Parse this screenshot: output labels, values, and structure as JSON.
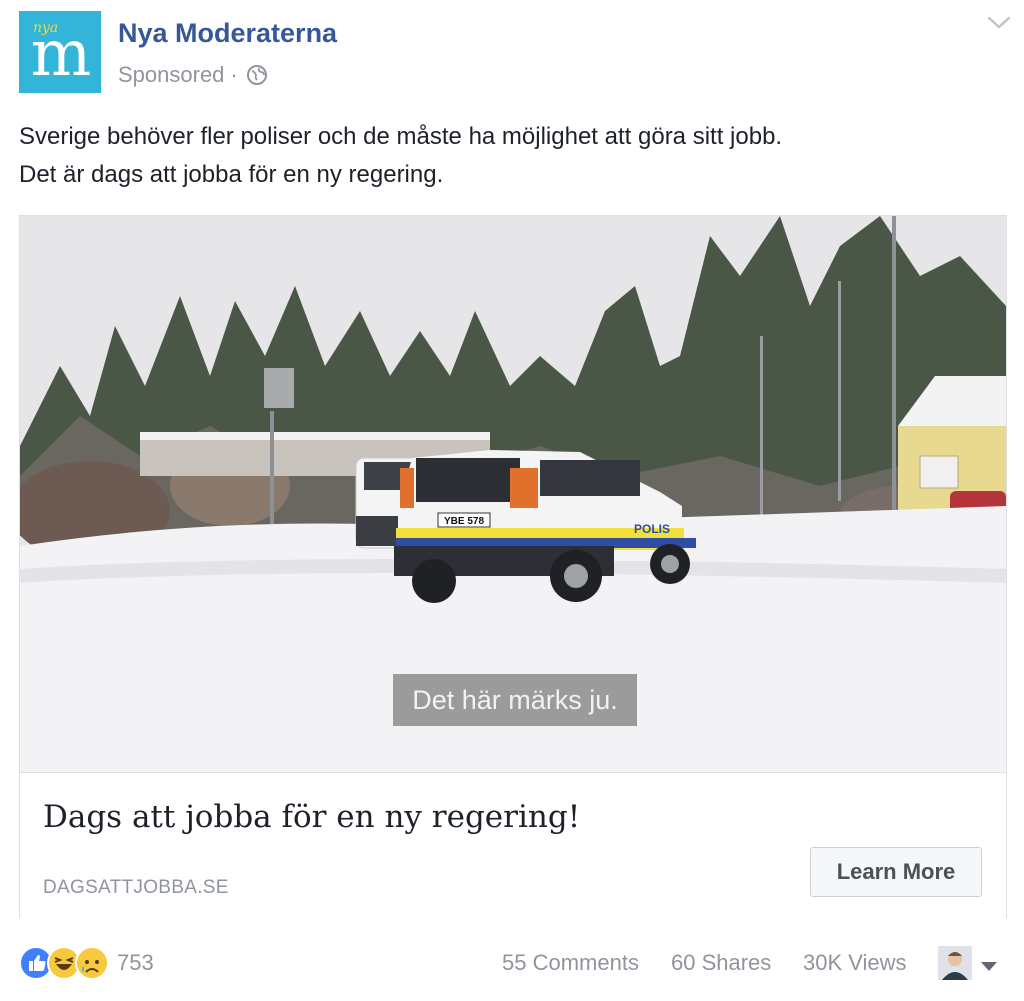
{
  "post": {
    "page_name": "Nya Moderaterna",
    "logo": {
      "letter": "m",
      "tagline": "nya",
      "background": "#33b5d9",
      "tagline_color": "#f7d33c"
    },
    "sponsored_label": "Sponsored",
    "separator": "·",
    "audience_icon": "globe-icon",
    "menu_icon": "chevron-down-icon",
    "text_lines": [
      "Sverige behöver fler poliser och de måste ha möjlighet att göra sitt jobb.",
      "Det är dags att jobba för en ny regering."
    ]
  },
  "media": {
    "caption": "Det här märks ju.",
    "license_plate": "YBE 578",
    "vehicle_text": "POLIS"
  },
  "link": {
    "title": "Dags att jobba för en ny regering!",
    "domain": "DAGSATTJOBBA.SE",
    "cta_label": "Learn More"
  },
  "footer": {
    "reaction_icons": [
      "like-icon",
      "haha-icon",
      "sad-icon"
    ],
    "reaction_count": "753",
    "comments": "55 Comments",
    "shares": "60 Shares",
    "views": "30K Views",
    "viewer_icon": "avatar",
    "dropdown_icon": "caret-down-icon"
  },
  "colors": {
    "name_link": "#365899",
    "meta_text": "#90949c",
    "body_text": "#1d2129",
    "border": "#dddfe2",
    "like_blue": "#4080ff",
    "emoji_yellow": "#f7c93e"
  }
}
